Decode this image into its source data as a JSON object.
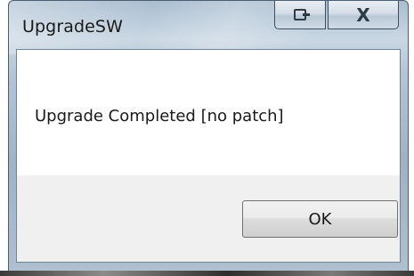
{
  "window": {
    "title": "UpgradeSW"
  },
  "caption_buttons": {
    "restore_icon": "restore-icon",
    "close_glyph": "X"
  },
  "dialog": {
    "message": "Upgrade Completed [no patch]",
    "ok_label": "OK"
  },
  "colors": {
    "titlebar": "#b2c4d5",
    "client_bg": "#ffffff",
    "footer_bg": "#f0f0f0",
    "button_border": "#707070"
  }
}
